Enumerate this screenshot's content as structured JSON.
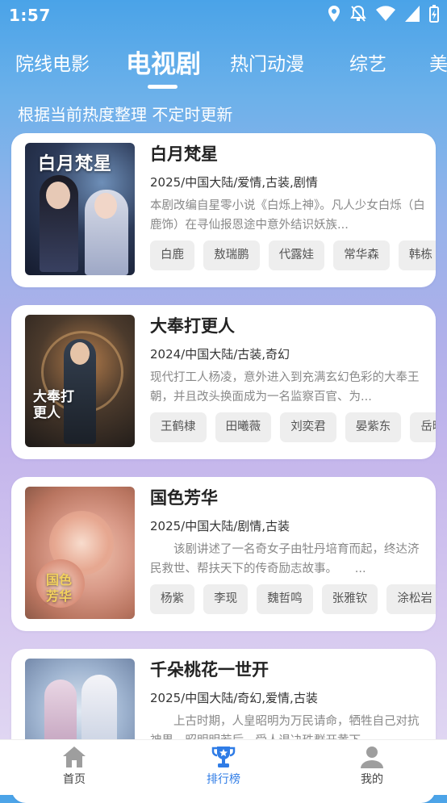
{
  "status_bar": {
    "time": "1:57"
  },
  "tabs": [
    {
      "label": "院线电影"
    },
    {
      "label": "电视剧"
    },
    {
      "label": "热门动漫"
    },
    {
      "label": "综艺"
    },
    {
      "label": "美"
    }
  ],
  "subtitle": "根据当前热度整理 不定时更新",
  "shows": [
    {
      "title": "白月梵星",
      "poster_text": "白月梵星",
      "meta": "2025/中国大陆/爱情,古装,剧情",
      "desc": "本剧改编自星零小说《白烁上神》。凡人少女白烁（白鹿饰）在寻仙报恩途中意外结识妖族...",
      "cast": [
        "白鹿",
        "敖瑞鹏",
        "代露娃",
        "常华森",
        "韩栋",
        "..."
      ]
    },
    {
      "title": "大奉打更人",
      "poster_text": "大奉打更人",
      "meta": "2024/中国大陆/古装,奇幻",
      "desc": "现代打工人杨凌，意外进入到充满玄幻色彩的大奉王朝，并且改头换面成为一名监察百官、为...",
      "cast": [
        "王鹤棣",
        "田曦薇",
        "刘奕君",
        "晏紫东",
        "岳旸"
      ]
    },
    {
      "title": "国色芳华",
      "poster_text": "国色芳华",
      "meta": "2025/中国大陆/剧情,古装",
      "desc": "　　该剧讲述了一名奇女子由牡丹培育而起，终达济民救世、帮扶天下的传奇励志故事。　　...",
      "cast": [
        "杨紫",
        "李现",
        "魏哲鸣",
        "张雅钦",
        "涂松岩",
        "..."
      ]
    },
    {
      "title": "千朵桃花一世开",
      "poster_text": "",
      "meta": "2025/中国大陆/奇幻,爱情,古装",
      "desc": "　　上古时期，人皇昭明为万民请命，牺牲自己对抗神界，昭明明若后，受人退决珠群开黄下...",
      "cast": []
    }
  ],
  "bottom_nav": [
    {
      "label": "首页",
      "icon": "home-icon"
    },
    {
      "label": "排行榜",
      "icon": "trophy-icon"
    },
    {
      "label": "我的",
      "icon": "user-icon"
    }
  ],
  "colors": {
    "accent": "#2f7ce6",
    "chip_bg": "#eeeeee",
    "gradient_top": "#4aa3e8",
    "gradient_bottom": "#e4dcf3"
  }
}
